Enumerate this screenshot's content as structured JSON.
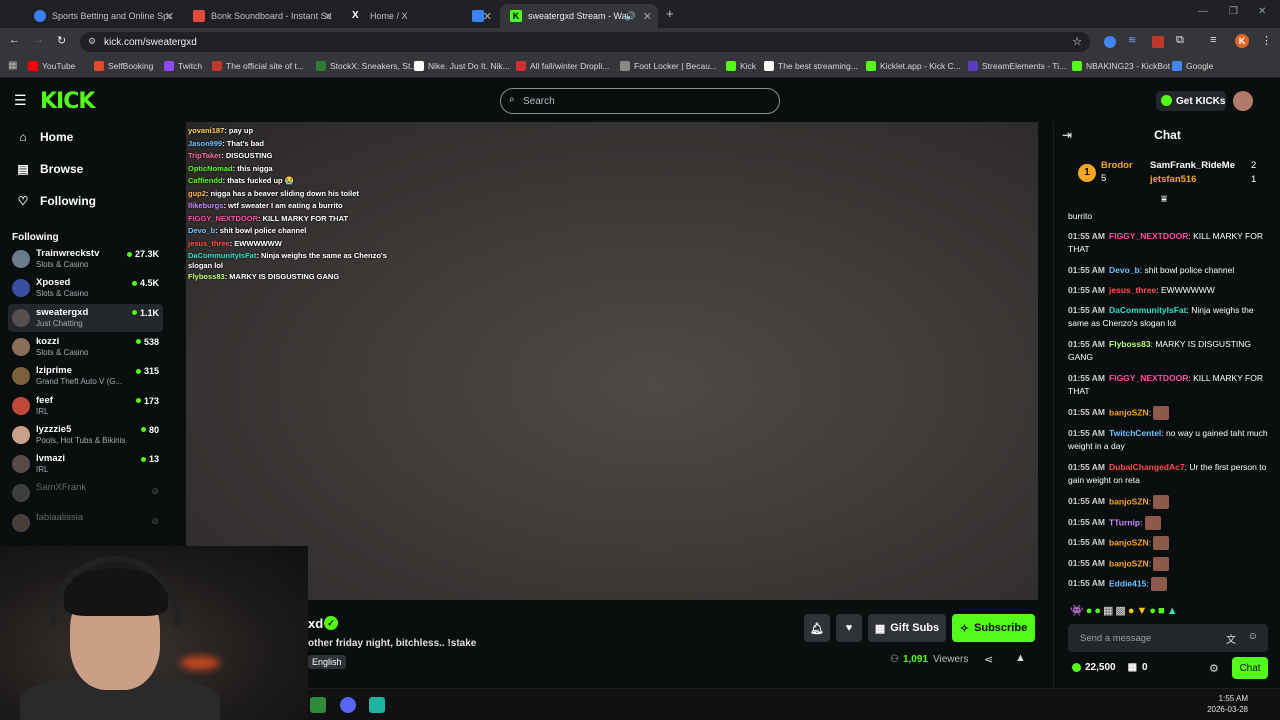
{
  "browser": {
    "tabs": [
      {
        "label": "Sports Betting and Online Sports",
        "color": "#3b82f6"
      },
      {
        "label": "Bonk Soundboard - Instant Sou",
        "color": "#e04b3b"
      },
      {
        "label": "Home / X",
        "color": "#ffffff"
      },
      {
        "label": "",
        "color": "#3b82f6"
      },
      {
        "label": "sweatergxd Stream - Watch",
        "color": "#53fc18"
      }
    ],
    "url": "kick.com/sweatergxd",
    "bookmarks": [
      {
        "label": "YouTube",
        "color": "#ff0000"
      },
      {
        "label": "SelfBooking",
        "color": "#e24b2a"
      },
      {
        "label": "Twitch",
        "color": "#9146ff"
      },
      {
        "label": "The official site of t...",
        "color": "#c0392b"
      },
      {
        "label": "StockX: Sneakers, St...",
        "color": "#2e7d32"
      },
      {
        "label": "Nike. Just Do It. Nik...",
        "color": "#ffffff"
      },
      {
        "label": "All fall/winter Dropli...",
        "color": "#d32f2f"
      },
      {
        "label": "Foot Locker | Becau...",
        "color": "#888888"
      },
      {
        "label": "Kick",
        "color": "#53fc18"
      },
      {
        "label": "The best streaming...",
        "color": "#ffffff"
      },
      {
        "label": "Kicklet.app - Kick C...",
        "color": "#53fc18"
      },
      {
        "label": "StreamElements - Ti...",
        "color": "#5b3cc4"
      },
      {
        "label": "NBAKING23 - KickBot",
        "color": "#53fc18"
      },
      {
        "label": "Google",
        "color": "#4285f4"
      }
    ]
  },
  "header": {
    "logo": "KICK",
    "search_placeholder": "Search",
    "get_kicks": "Get KICKs"
  },
  "sidebar": {
    "nav": [
      "Home",
      "Browse",
      "Following"
    ],
    "following_heading": "Following",
    "channels": [
      {
        "name": "Trainwreckstv",
        "category": "Slots & Casino",
        "viewers": "27.3K",
        "color": "#6a7b8a"
      },
      {
        "name": "Xposed",
        "category": "Slots & Casino",
        "viewers": "4.5K",
        "color": "#3a4fa0"
      },
      {
        "name": "sweatergxd",
        "category": "Just Chatting",
        "viewers": "1.1K",
        "color": "#55504d"
      },
      {
        "name": "kozzi",
        "category": "Slots & Casino",
        "viewers": "538",
        "color": "#8a6f5a"
      },
      {
        "name": "Iziprime",
        "category": "Grand Theft Auto V (G...",
        "viewers": "315",
        "color": "#7a5f3a"
      },
      {
        "name": "feef",
        "category": "IRL",
        "viewers": "173",
        "color": "#c04a3a"
      },
      {
        "name": "lyzzzie5",
        "category": "Pools, Hot Tubs & Bikinis",
        "viewers": "80",
        "color": "#c9a08a"
      },
      {
        "name": "lvmazi",
        "category": "IRL",
        "viewers": "13",
        "color": "#5a4a4a"
      },
      {
        "name": "SamXFrank",
        "category": "",
        "viewers": "",
        "color": "#888888"
      },
      {
        "name": "fabiaalissia",
        "category": "",
        "viewers": "",
        "color": "#a08a80"
      }
    ]
  },
  "overlay_chat": [
    {
      "user": "yovani187",
      "text": "pay up",
      "color": "#ffd15c"
    },
    {
      "user": "Jason999",
      "text": "That's bad",
      "color": "#6ec1ff"
    },
    {
      "user": "TripTaker",
      "text": "DISGUSTING",
      "color": "#ff6b9e"
    },
    {
      "user": "OpticNomad",
      "text": "this nigga",
      "color": "#53fc18"
    },
    {
      "user": "Caffiendd",
      "text": "thats fucked up 😭",
      "color": "#53fc18"
    },
    {
      "user": "gup2",
      "text": "nigga has a beaver sliding down his toilet",
      "color": "#ffb347"
    },
    {
      "user": "llikeburgs",
      "text": "wtf sweater I am eating a burrito",
      "color": "#c58aff"
    },
    {
      "user": "FIGGY_NEXTDOOR",
      "text": "KILL MARKY FOR THAT",
      "color": "#ff4fa0"
    },
    {
      "user": "Devo_b",
      "text": "shit bowl police channel",
      "color": "#6ec1ff"
    },
    {
      "user": "jesus_three",
      "text": "EWWWWWW",
      "color": "#ff4f4f"
    },
    {
      "user": "DaCommunityIsFat",
      "text": "Ninja weighs the same as Chenzo's slogan lol",
      "color": "#2fe0c8"
    },
    {
      "user": "Flyboss83",
      "text": "MARKY IS DISGUSTING GANG",
      "color": "#b7ff7a"
    }
  ],
  "stream": {
    "title_fragment": "xd",
    "subtitle": "other friday night, bitchless.. !stake",
    "language": "English",
    "gift_subs": "Gift Subs",
    "subscribe": "Subscribe",
    "viewers_count": "1,091",
    "viewers_label": "Viewers"
  },
  "taskbar": {
    "time": "1:55 AM",
    "date": "2026-03-28"
  },
  "chat": {
    "title": "Chat",
    "gifters": [
      {
        "name": "Brodor",
        "count": "5",
        "color": "#f5a623"
      },
      {
        "name": "SamFrank_RideMe",
        "count": "2",
        "color": "#ffffff"
      },
      {
        "name": "jetsfan516",
        "count": "1",
        "color": "#f5a623"
      }
    ],
    "messages": [
      {
        "time": "",
        "user": "",
        "text": "burrito",
        "color": "#ffffff"
      },
      {
        "time": "01:55 AM",
        "user": "FIGGY_NEXTDOOR",
        "text": "KILL MARKY FOR THAT",
        "color": "#ff4fa0"
      },
      {
        "time": "01:55 AM",
        "user": "Devo_b",
        "text": "shit bowl police channel",
        "color": "#6ec1ff"
      },
      {
        "time": "01:55 AM",
        "user": "jesus_three",
        "text": "EWWWWWW",
        "color": "#ff4f4f"
      },
      {
        "time": "01:55 AM",
        "user": "DaCommunityIsFat",
        "text": "Ninja weighs the same as Chenzo's slogan lol",
        "color": "#2fe0c8"
      },
      {
        "time": "01:55 AM",
        "user": "Flyboss83",
        "text": "MARKY IS DISGUSTING GANG",
        "color": "#b7ff7a"
      },
      {
        "time": "01:55 AM",
        "user": "FIGGY_NEXTDOOR",
        "text": "KILL MARKY FOR THAT",
        "color": "#ff4fa0"
      },
      {
        "time": "01:55 AM",
        "user": "banjoSZN",
        "text": "",
        "color": "#f5a623"
      },
      {
        "time": "01:55 AM",
        "user": "TwitchCentel",
        "text": "no way u gained taht much weight in a day",
        "color": "#6ec1ff"
      },
      {
        "time": "01:55 AM",
        "user": "DubaiChangedAc7",
        "text": "Ur the first person to gain weight on reta",
        "color": "#ff4f4f"
      },
      {
        "time": "01:55 AM",
        "user": "banjoSZN",
        "text": "",
        "color": "#f5a623"
      },
      {
        "time": "01:55 AM",
        "user": "TTurnip",
        "text": "",
        "color": "#c58aff"
      },
      {
        "time": "01:55 AM",
        "user": "banjoSZN",
        "text": "",
        "color": "#f5a623"
      },
      {
        "time": "01:55 AM",
        "user": "banjoSZN",
        "text": "",
        "color": "#f5a623"
      },
      {
        "time": "01:55 AM",
        "user": "Eddie415",
        "text": "",
        "color": "#6ec1ff"
      }
    ],
    "input_placeholder": "Send a message",
    "kicks_balance": "22,500",
    "gift_count": "0",
    "send_label": "Chat"
  },
  "colors": {
    "accent": "#53fc18",
    "background": "#0b0e0f"
  }
}
